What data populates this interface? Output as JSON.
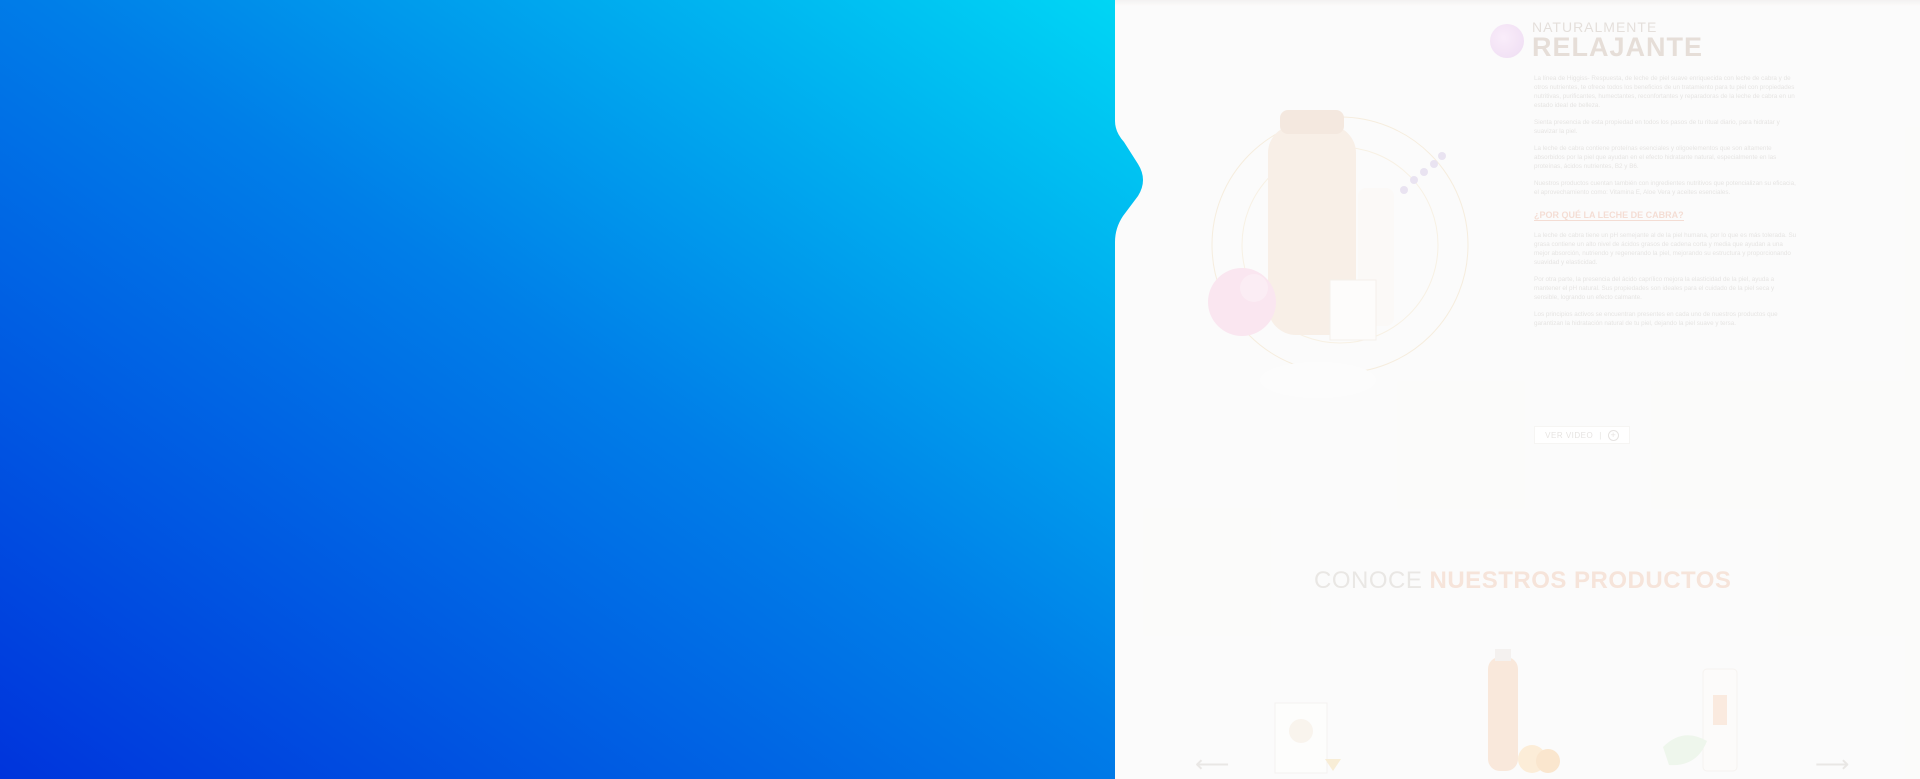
{
  "colors": {
    "blue_start": "#00d3f5",
    "blue_end": "#0034dc",
    "accent": "#ecc3ad"
  },
  "hero": {
    "eyebrow": "NATURALMENTE",
    "title": "RELAJANTE",
    "icon": "lotus-icon"
  },
  "content": {
    "paragraph1": "La línea de Higgiss- Respuesta, de leche de piel suave enriquecida con leche de cabra y de otros nutrientes, te ofrece todos los beneficios de un tratamiento para tu piel con propiedades nutritivas, purificantes, humectantes, reconfortantes y reparadoras de la leche de cabra en un estado ideal de belleza.",
    "paragraph2": "Sienta presencia de esta propiedad en todos los pasos de tu ritual diario, para hidratar y suavizar la piel.",
    "paragraph3": "La leche de cabra contiene proteínas esenciales y oligoelementos que son altamente absorbidos por la piel que ayudan en el efecto hidratante natural, especialmente en las proteínas, ácidos nutrientes, B2 y B6.",
    "paragraph4": "Nuestros productos cuentan también con ingredientes nutritivos que potencializan su eficacia, el aprovechamiento como: Vitamina E, Aloe Vera y aceites esenciales.",
    "subheading": "¿POR QUÉ LA LECHE DE CABRA?",
    "paragraph5": "La leche de cabra tiene un pH semejante al de la piel humana, por lo que es más tolerada. Su grasa contiene un alto nivel de ácidos grasos de cadena corta y media que ayudan a una mejor absorción, nutriendo y regenerando la piel, mejorando su estructura y proporcionando suavidad y elasticidad.",
    "paragraph6": "Por otra parte, la presencia del ácido caprílico mejora la elasticidad de la piel, ayuda a mantener el pH natural. Sus propiedades son ideales para el cuidado de la piel seca y sensible, logrando un efecto calmante.",
    "paragraph7": "Los principios activos se encuentran presentes en cada uno de nuestros productos que garantizan la hidratación natural de tu piel, dejando la piel suave y tersa."
  },
  "video_button": {
    "label": "VER VIDEO",
    "icon": "plus-circle-icon"
  },
  "products_section": {
    "title_light": "CONOCE",
    "title_bold": "NUESTROS PRODUCTOS",
    "prev_icon": "arrow-left-icon",
    "next_icon": "arrow-right-icon"
  }
}
